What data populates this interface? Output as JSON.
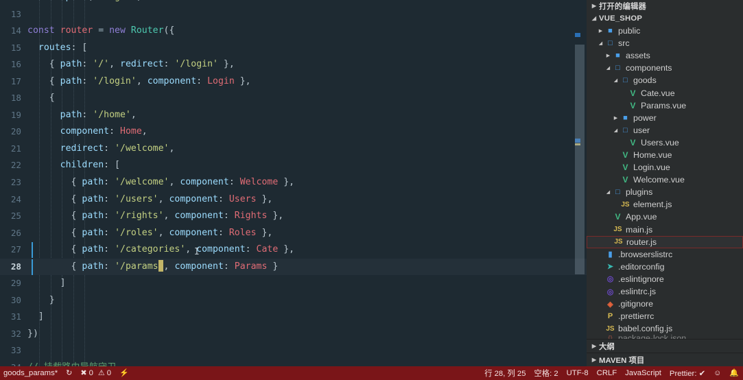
{
  "window": {
    "app": "vscode-editor"
  },
  "editor": {
    "language": "JavaScript",
    "cut_top_line": "router.push('/login')",
    "lines": [
      {
        "num": "13",
        "active": false,
        "indent": 0,
        "tokens": []
      },
      {
        "num": "14",
        "active": false,
        "indent": 0,
        "tokens": [
          {
            "t": "const ",
            "c": "kw"
          },
          {
            "t": "router",
            "c": "var"
          },
          {
            "t": " = ",
            "c": "op"
          },
          {
            "t": "new ",
            "c": "kw"
          },
          {
            "t": "Router",
            "c": "cls"
          },
          {
            "t": "({",
            "c": "punc"
          }
        ]
      },
      {
        "num": "15",
        "active": false,
        "indent": 1,
        "tokens": [
          {
            "t": "  ",
            "c": "plain"
          },
          {
            "t": "routes",
            "c": "prop"
          },
          {
            "t": ": [",
            "c": "punc"
          }
        ]
      },
      {
        "num": "16",
        "active": false,
        "indent": 2,
        "tokens": [
          {
            "t": "    { ",
            "c": "punc"
          },
          {
            "t": "path",
            "c": "prop"
          },
          {
            "t": ": ",
            "c": "punc"
          },
          {
            "t": "'/'",
            "c": "str"
          },
          {
            "t": ", ",
            "c": "punc"
          },
          {
            "t": "redirect",
            "c": "prop"
          },
          {
            "t": ": ",
            "c": "punc"
          },
          {
            "t": "'/login'",
            "c": "str"
          },
          {
            "t": " },",
            "c": "punc"
          }
        ]
      },
      {
        "num": "17",
        "active": false,
        "indent": 2,
        "tokens": [
          {
            "t": "    { ",
            "c": "punc"
          },
          {
            "t": "path",
            "c": "prop"
          },
          {
            "t": ": ",
            "c": "punc"
          },
          {
            "t": "'/login'",
            "c": "str"
          },
          {
            "t": ", ",
            "c": "punc"
          },
          {
            "t": "component",
            "c": "prop"
          },
          {
            "t": ": ",
            "c": "punc"
          },
          {
            "t": "Login",
            "c": "comp"
          },
          {
            "t": " },",
            "c": "punc"
          }
        ]
      },
      {
        "num": "18",
        "active": false,
        "indent": 2,
        "tokens": [
          {
            "t": "    {",
            "c": "punc"
          }
        ]
      },
      {
        "num": "19",
        "active": false,
        "indent": 3,
        "tokens": [
          {
            "t": "      ",
            "c": "plain"
          },
          {
            "t": "path",
            "c": "prop"
          },
          {
            "t": ": ",
            "c": "punc"
          },
          {
            "t": "'/home'",
            "c": "str"
          },
          {
            "t": ",",
            "c": "punc"
          }
        ]
      },
      {
        "num": "20",
        "active": false,
        "indent": 3,
        "tokens": [
          {
            "t": "      ",
            "c": "plain"
          },
          {
            "t": "component",
            "c": "prop"
          },
          {
            "t": ": ",
            "c": "punc"
          },
          {
            "t": "Home",
            "c": "comp"
          },
          {
            "t": ",",
            "c": "punc"
          }
        ]
      },
      {
        "num": "21",
        "active": false,
        "indent": 3,
        "tokens": [
          {
            "t": "      ",
            "c": "plain"
          },
          {
            "t": "redirect",
            "c": "prop"
          },
          {
            "t": ": ",
            "c": "punc"
          },
          {
            "t": "'/welcome'",
            "c": "str"
          },
          {
            "t": ",",
            "c": "punc"
          }
        ]
      },
      {
        "num": "22",
        "active": false,
        "indent": 3,
        "tokens": [
          {
            "t": "      ",
            "c": "plain"
          },
          {
            "t": "children",
            "c": "prop"
          },
          {
            "t": ": [",
            "c": "punc"
          }
        ]
      },
      {
        "num": "23",
        "active": false,
        "indent": 4,
        "tokens": [
          {
            "t": "        { ",
            "c": "punc"
          },
          {
            "t": "path",
            "c": "prop"
          },
          {
            "t": ": ",
            "c": "punc"
          },
          {
            "t": "'/welcome'",
            "c": "str"
          },
          {
            "t": ", ",
            "c": "punc"
          },
          {
            "t": "component",
            "c": "prop"
          },
          {
            "t": ": ",
            "c": "punc"
          },
          {
            "t": "Welcome",
            "c": "comp"
          },
          {
            "t": " },",
            "c": "punc"
          }
        ]
      },
      {
        "num": "24",
        "active": false,
        "indent": 4,
        "tokens": [
          {
            "t": "        { ",
            "c": "punc"
          },
          {
            "t": "path",
            "c": "prop"
          },
          {
            "t": ": ",
            "c": "punc"
          },
          {
            "t": "'/users'",
            "c": "str"
          },
          {
            "t": ", ",
            "c": "punc"
          },
          {
            "t": "component",
            "c": "prop"
          },
          {
            "t": ": ",
            "c": "punc"
          },
          {
            "t": "Users",
            "c": "comp"
          },
          {
            "t": " },",
            "c": "punc"
          }
        ]
      },
      {
        "num": "25",
        "active": false,
        "indent": 4,
        "tokens": [
          {
            "t": "        { ",
            "c": "punc"
          },
          {
            "t": "path",
            "c": "prop"
          },
          {
            "t": ": ",
            "c": "punc"
          },
          {
            "t": "'/rights'",
            "c": "str"
          },
          {
            "t": ", ",
            "c": "punc"
          },
          {
            "t": "component",
            "c": "prop"
          },
          {
            "t": ": ",
            "c": "punc"
          },
          {
            "t": "Rights",
            "c": "comp"
          },
          {
            "t": " },",
            "c": "punc"
          }
        ]
      },
      {
        "num": "26",
        "active": false,
        "indent": 4,
        "tokens": [
          {
            "t": "        { ",
            "c": "punc"
          },
          {
            "t": "path",
            "c": "prop"
          },
          {
            "t": ": ",
            "c": "punc"
          },
          {
            "t": "'/roles'",
            "c": "str"
          },
          {
            "t": ", ",
            "c": "punc"
          },
          {
            "t": "component",
            "c": "prop"
          },
          {
            "t": ": ",
            "c": "punc"
          },
          {
            "t": "Roles",
            "c": "comp"
          },
          {
            "t": " },",
            "c": "punc"
          }
        ]
      },
      {
        "num": "27",
        "active": false,
        "indent": 4,
        "tokens": [
          {
            "t": "        { ",
            "c": "punc"
          },
          {
            "t": "path",
            "c": "prop"
          },
          {
            "t": ": ",
            "c": "punc"
          },
          {
            "t": "'/categories'",
            "c": "str"
          },
          {
            "t": ", ",
            "c": "punc"
          },
          {
            "t": "component",
            "c": "prop"
          },
          {
            "t": ": ",
            "c": "punc"
          },
          {
            "t": "Cate",
            "c": "comp"
          },
          {
            "t": " },",
            "c": "punc"
          }
        ]
      },
      {
        "num": "28",
        "active": true,
        "indent": 4,
        "tokens": [
          {
            "t": "        { ",
            "c": "punc"
          },
          {
            "t": "path",
            "c": "prop"
          },
          {
            "t": ": ",
            "c": "punc"
          },
          {
            "t": "'/params",
            "c": "str"
          },
          {
            "t": "'",
            "c": "str"
          },
          {
            "t": ", ",
            "c": "punc"
          },
          {
            "t": "component",
            "c": "prop"
          },
          {
            "t": ": ",
            "c": "punc"
          },
          {
            "t": "Params",
            "c": "comp"
          },
          {
            "t": " }",
            "c": "punc"
          }
        ]
      },
      {
        "num": "29",
        "active": false,
        "indent": 3,
        "tokens": [
          {
            "t": "      ]",
            "c": "punc"
          }
        ]
      },
      {
        "num": "30",
        "active": false,
        "indent": 2,
        "tokens": [
          {
            "t": "    }",
            "c": "punc"
          }
        ]
      },
      {
        "num": "31",
        "active": false,
        "indent": 1,
        "tokens": [
          {
            "t": "  ]",
            "c": "punc"
          }
        ]
      },
      {
        "num": "32",
        "active": false,
        "indent": 0,
        "tokens": [
          {
            "t": "})",
            "c": "punc"
          }
        ]
      },
      {
        "num": "33",
        "active": false,
        "indent": 0,
        "tokens": []
      },
      {
        "num": "34",
        "active": false,
        "indent": 0,
        "tokens": [
          {
            "t": "// 挂载路由导航守卫",
            "c": "cmt"
          }
        ]
      }
    ]
  },
  "sidebar": {
    "open_editors_label": "打开的编辑器",
    "project_label": "VUE_SHOP",
    "tree": [
      {
        "label": "public",
        "icon": "folder",
        "depth": 1,
        "arrow": "right",
        "selected": false
      },
      {
        "label": "src",
        "icon": "folder-open",
        "depth": 1,
        "arrow": "down",
        "selected": false
      },
      {
        "label": "assets",
        "icon": "folder",
        "depth": 2,
        "arrow": "right",
        "selected": false
      },
      {
        "label": "components",
        "icon": "folder-open",
        "depth": 2,
        "arrow": "down",
        "selected": false
      },
      {
        "label": "goods",
        "icon": "folder-open",
        "depth": 3,
        "arrow": "down",
        "selected": false
      },
      {
        "label": "Cate.vue",
        "icon": "vue",
        "depth": 4,
        "arrow": "none",
        "selected": false
      },
      {
        "label": "Params.vue",
        "icon": "vue",
        "depth": 4,
        "arrow": "none",
        "selected": false
      },
      {
        "label": "power",
        "icon": "folder",
        "depth": 3,
        "arrow": "right",
        "selected": false
      },
      {
        "label": "user",
        "icon": "folder-open",
        "depth": 3,
        "arrow": "down",
        "selected": false
      },
      {
        "label": "Users.vue",
        "icon": "vue",
        "depth": 4,
        "arrow": "none",
        "selected": false
      },
      {
        "label": "Home.vue",
        "icon": "vue",
        "depth": 3,
        "arrow": "none",
        "selected": false
      },
      {
        "label": "Login.vue",
        "icon": "vue",
        "depth": 3,
        "arrow": "none",
        "selected": false
      },
      {
        "label": "Welcome.vue",
        "icon": "vue",
        "depth": 3,
        "arrow": "none",
        "selected": false
      },
      {
        "label": "plugins",
        "icon": "folder-open",
        "depth": 2,
        "arrow": "down",
        "selected": false
      },
      {
        "label": "element.js",
        "icon": "js",
        "depth": 3,
        "arrow": "none",
        "selected": false
      },
      {
        "label": "App.vue",
        "icon": "vue",
        "depth": 2,
        "arrow": "none",
        "selected": false
      },
      {
        "label": "main.js",
        "icon": "js",
        "depth": 2,
        "arrow": "none",
        "selected": false
      },
      {
        "label": "router.js",
        "icon": "js",
        "depth": 2,
        "arrow": "none",
        "selected": true
      },
      {
        "label": ".browserslistrc",
        "icon": "blue-doc",
        "depth": 1,
        "arrow": "none",
        "selected": false
      },
      {
        "label": ".editorconfig",
        "icon": "editorconfig",
        "depth": 1,
        "arrow": "none",
        "selected": false
      },
      {
        "label": ".eslintignore",
        "icon": "eslint",
        "depth": 1,
        "arrow": "none",
        "selected": false
      },
      {
        "label": ".eslintrc.js",
        "icon": "eslint",
        "depth": 1,
        "arrow": "none",
        "selected": false
      },
      {
        "label": ".gitignore",
        "icon": "git",
        "depth": 1,
        "arrow": "none",
        "selected": false
      },
      {
        "label": ".prettierrc",
        "icon": "prettier",
        "depth": 1,
        "arrow": "none",
        "selected": false
      },
      {
        "label": "babel.config.js",
        "icon": "js",
        "depth": 1,
        "arrow": "none",
        "selected": false
      },
      {
        "label": "package-lock.json",
        "icon": "json",
        "depth": 1,
        "arrow": "none",
        "selected": false
      }
    ],
    "bottom_sections": [
      {
        "label": "大纲"
      },
      {
        "label": "MAVEN 项目"
      }
    ]
  },
  "statusbar": {
    "branch": "goods_params*",
    "sync_icon": "sync-icon",
    "errors_icon": "error-icon",
    "errors": "0",
    "warnings_icon": "warning-icon",
    "warnings": "0",
    "radio_icon": "lightning-icon",
    "cursor_position": "行 28, 列 25",
    "indentation": "空格: 2",
    "encoding": "UTF-8",
    "eol": "CRLF",
    "language": "JavaScript",
    "prettier": "Prettier: ✔",
    "feedback_icon": "smiley-icon",
    "bell_icon": "bell-icon"
  },
  "colors": {
    "editor_bg": "#1e2a32",
    "sidebar_bg": "#2a2d2e",
    "statusbar_bg": "#7a1518",
    "accent": "#3a9bd8",
    "vue_green": "#41b883"
  }
}
